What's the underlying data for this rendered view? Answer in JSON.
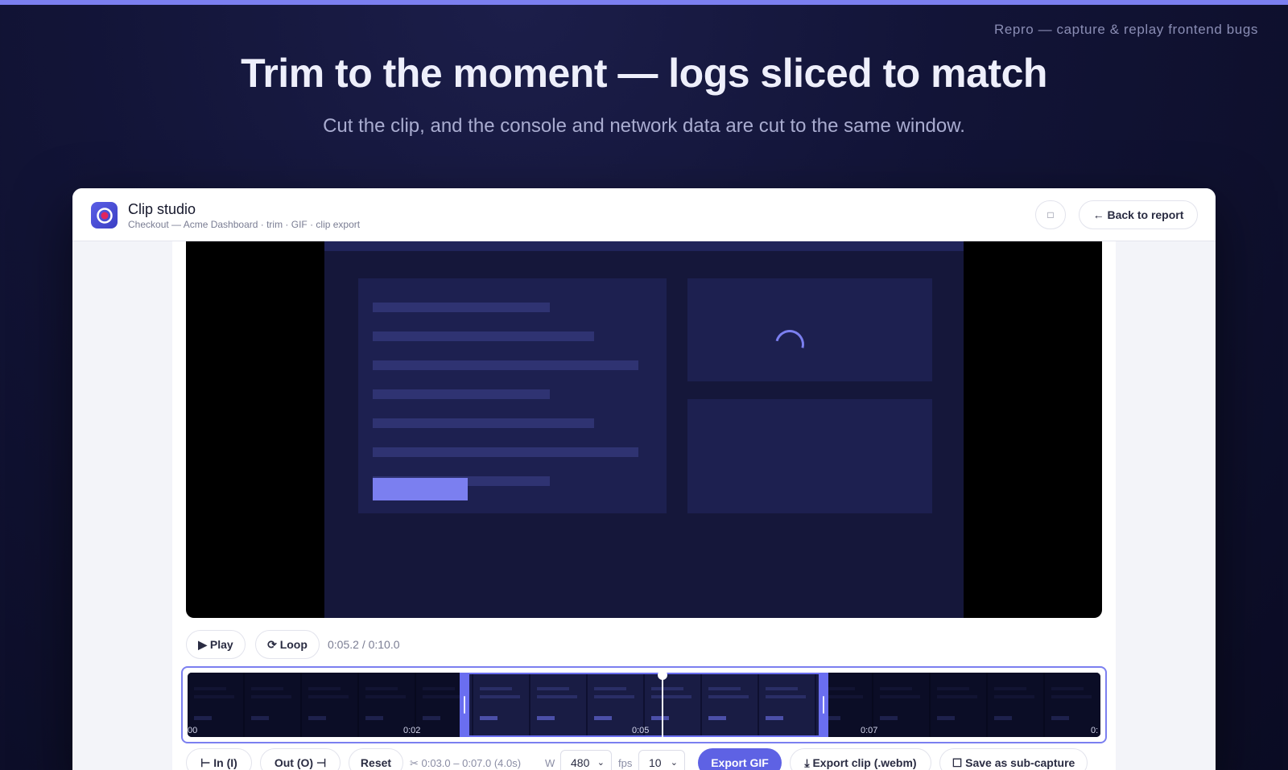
{
  "marketing": {
    "brand_tag": "Repro — capture & replay frontend bugs",
    "headline": "Trim to the moment — logs sliced to match",
    "subhead": "Cut the clip, and the console and network data are cut to the same window."
  },
  "window": {
    "title": "Clip studio",
    "subtitle": "Checkout — Acme Dashboard · trim · GIF · clip export",
    "square_button_glyph": "□",
    "back_label": "← Back to report"
  },
  "player": {
    "play_label": "▶ Play",
    "loop_label": "⟳ Loop",
    "time_readout": "0:05.2 / 0:10.0",
    "current_time_s": 5.2,
    "duration_s": 10.0
  },
  "timeline": {
    "ticks": [
      "00",
      "0:02",
      "0:05",
      "0:07",
      "0:"
    ],
    "in_s": 3.0,
    "out_s": 7.0,
    "playhead_s": 5.2
  },
  "toolbar": {
    "in_label": "⊢ In (I)",
    "out_label": "Out (O) ⊣",
    "reset_label": "Reset",
    "range_readout": "✂ 0:03.0 – 0:07.0 (4.0s)",
    "width_label": "W",
    "width_value": "480",
    "fps_label": "fps",
    "fps_value": "10",
    "export_gif_label": "Export GIF",
    "export_clip_label": "⤓ Export clip (.webm)",
    "save_sub_label": "☐ Save as sub-capture"
  },
  "colors": {
    "accent": "#7b7ff0",
    "primary_button": "#5e62e4",
    "background": "#121437"
  }
}
